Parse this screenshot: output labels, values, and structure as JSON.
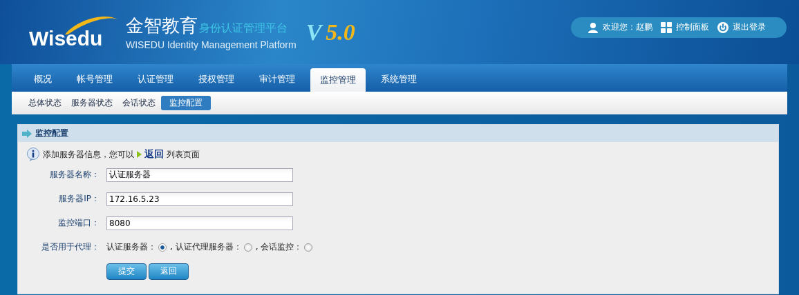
{
  "header": {
    "logo": "Wisedu",
    "brand": "金智教育",
    "product": "身份认证管理平台",
    "subtitle": "WISEDU Identity Management Platform",
    "version_letter": "V",
    "version_number": "5.0"
  },
  "user_bar": {
    "welcome": "欢迎您：赵鹏",
    "control_panel": "控制面板",
    "logout": "退出登录"
  },
  "tabs": [
    {
      "label": "概况",
      "selected": false
    },
    {
      "label": "帐号管理",
      "selected": false
    },
    {
      "label": "认证管理",
      "selected": false
    },
    {
      "label": "授权管理",
      "selected": false
    },
    {
      "label": "审计管理",
      "selected": false
    },
    {
      "label": "监控管理",
      "selected": true
    },
    {
      "label": "系统管理",
      "selected": false
    }
  ],
  "subtabs": [
    {
      "label": "总体状态",
      "selected": false
    },
    {
      "label": "服务器状态",
      "selected": false
    },
    {
      "label": "会话状态",
      "selected": false
    },
    {
      "label": "监控配置",
      "selected": true
    }
  ],
  "panel": {
    "title": "监控配置",
    "info_before": "添加服务器信息，您可以",
    "info_link": "返回",
    "info_after": "列表页面",
    "fields": [
      {
        "label": "服务器名称：",
        "value": "认证服务器"
      },
      {
        "label": "服务器IP：",
        "value": "172.16.5.23"
      },
      {
        "label": "监控端口：",
        "value": "8080"
      }
    ],
    "proxy": {
      "label": "是否用于代理：",
      "options": [
        {
          "label": "认证服务器：",
          "selected": true
        },
        {
          "label": ", 认证代理服务器：",
          "selected": false
        },
        {
          "label": ", 会话监控：",
          "selected": false
        }
      ]
    },
    "buttons": [
      "提交",
      "返回"
    ]
  }
}
